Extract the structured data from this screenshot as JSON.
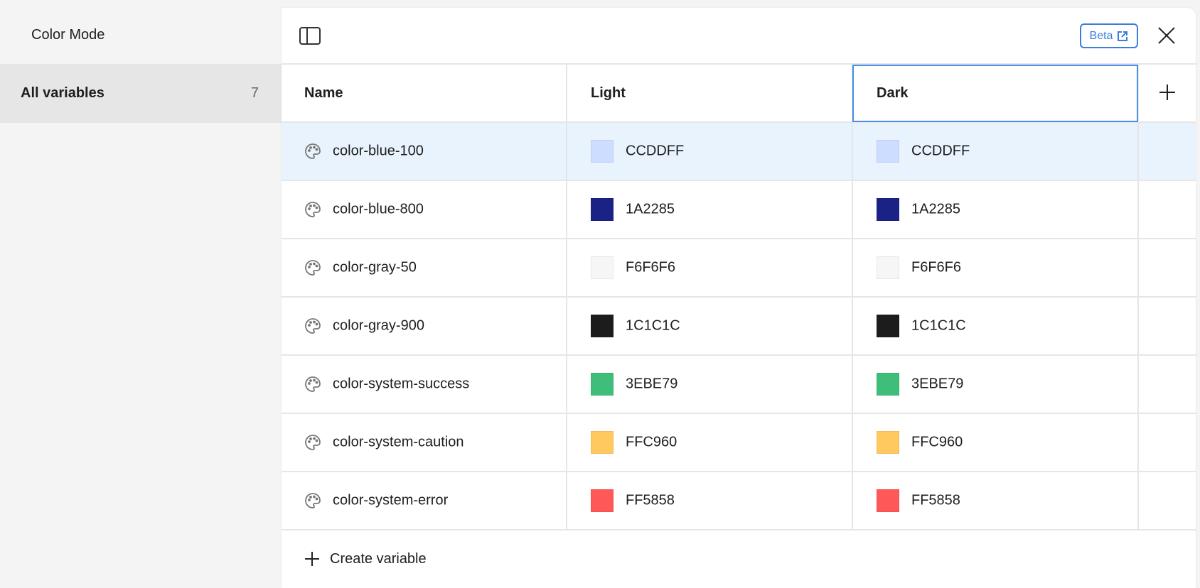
{
  "sidebar": {
    "title": "Color Mode",
    "items": [
      {
        "label": "All variables",
        "count": "7"
      }
    ]
  },
  "header": {
    "beta_label": "Beta"
  },
  "table": {
    "columns": [
      "Name",
      "Light",
      "Dark"
    ],
    "rows": [
      {
        "name": "color-blue-100",
        "light": "CCDDFF",
        "dark": "CCDDFF",
        "light_color": "#CCDDFF",
        "dark_color": "#CCDDFF"
      },
      {
        "name": "color-blue-800",
        "light": "1A2285",
        "dark": "1A2285",
        "light_color": "#1A2285",
        "dark_color": "#1A2285"
      },
      {
        "name": "color-gray-50",
        "light": "F6F6F6",
        "dark": "F6F6F6",
        "light_color": "#F6F6F6",
        "dark_color": "#F6F6F6"
      },
      {
        "name": "color-gray-900",
        "light": "1C1C1C",
        "dark": "1C1C1C",
        "light_color": "#1C1C1C",
        "dark_color": "#1C1C1C"
      },
      {
        "name": "color-system-success",
        "light": "3EBE79",
        "dark": "3EBE79",
        "light_color": "#3EBE79",
        "dark_color": "#3EBE79"
      },
      {
        "name": "color-system-caution",
        "light": "FFC960",
        "dark": "FFC960",
        "light_color": "#FFC960",
        "dark_color": "#FFC960"
      },
      {
        "name": "color-system-error",
        "light": "FF5858",
        "dark": "FF5858",
        "light_color": "#FF5858",
        "dark_color": "#FF5858"
      }
    ]
  },
  "footer": {
    "create_label": "Create variable"
  }
}
